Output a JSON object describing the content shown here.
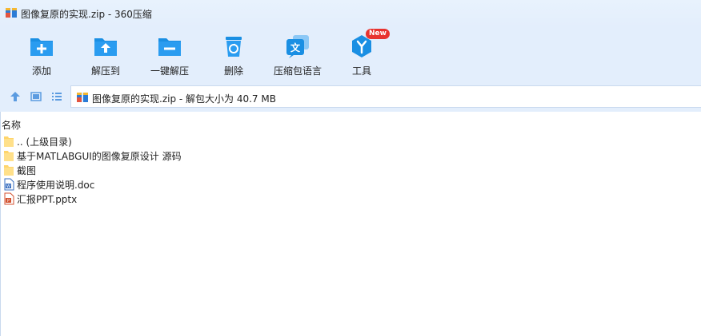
{
  "window": {
    "title": "图像复原的实现.zip - 360压缩"
  },
  "toolbar": {
    "buttons": [
      {
        "label": "添加",
        "icon": "add-icon"
      },
      {
        "label": "解压到",
        "icon": "extract-to-icon"
      },
      {
        "label": "一键解压",
        "icon": "one-click-extract-icon"
      },
      {
        "label": "删除",
        "icon": "delete-icon"
      },
      {
        "label": "压缩包语言",
        "icon": "archive-language-icon"
      },
      {
        "label": "工具",
        "icon": "tools-icon",
        "badge": "New"
      }
    ]
  },
  "address": {
    "text": "图像复原的实现.zip - 解包大小为 40.7 MB"
  },
  "list": {
    "column_name": "名称",
    "items": [
      {
        "name": ".. (上级目录)",
        "type": "folder"
      },
      {
        "name": "基于MATLABGUI的图像复原设计 源码",
        "type": "folder"
      },
      {
        "name": "截图",
        "type": "folder"
      },
      {
        "name": "程序使用说明.doc",
        "type": "doc"
      },
      {
        "name": "汇报PPT.pptx",
        "type": "ppt"
      }
    ]
  },
  "colors": {
    "accent": "#1a8fe3",
    "toolbar_bg": "#e3eefc",
    "folder": "#ffd56b"
  }
}
